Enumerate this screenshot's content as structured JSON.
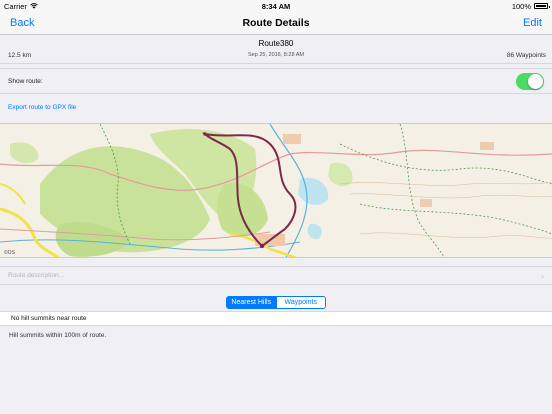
{
  "status": {
    "carrier": "Carrier",
    "time": "8:34 AM",
    "battery": "100%"
  },
  "nav": {
    "back_label": "Back",
    "title": "Route Details",
    "edit_label": "Edit"
  },
  "route": {
    "name": "Route380",
    "date": "Sep 25, 2016, 8:28 AM",
    "distance": "12.5 km",
    "waypoints": "86 Waypoints"
  },
  "settings": {
    "show_route_label": "Show route:",
    "show_route_on": true,
    "export_label": "Export route to GPX file"
  },
  "map": {
    "copyright_label": "©OS"
  },
  "description": {
    "placeholder": "Route description..."
  },
  "segments": {
    "nearest_hills": "Nearest Hills",
    "waypoints": "Waypoints",
    "selected": "Nearest Hills"
  },
  "hills": {
    "empty_message": "No hill summits near route",
    "footer": "Hill summits within 100m of route."
  },
  "colors": {
    "accent": "#007aff",
    "toggle_on": "#4cd964",
    "route_line": "#7a2a4a"
  }
}
